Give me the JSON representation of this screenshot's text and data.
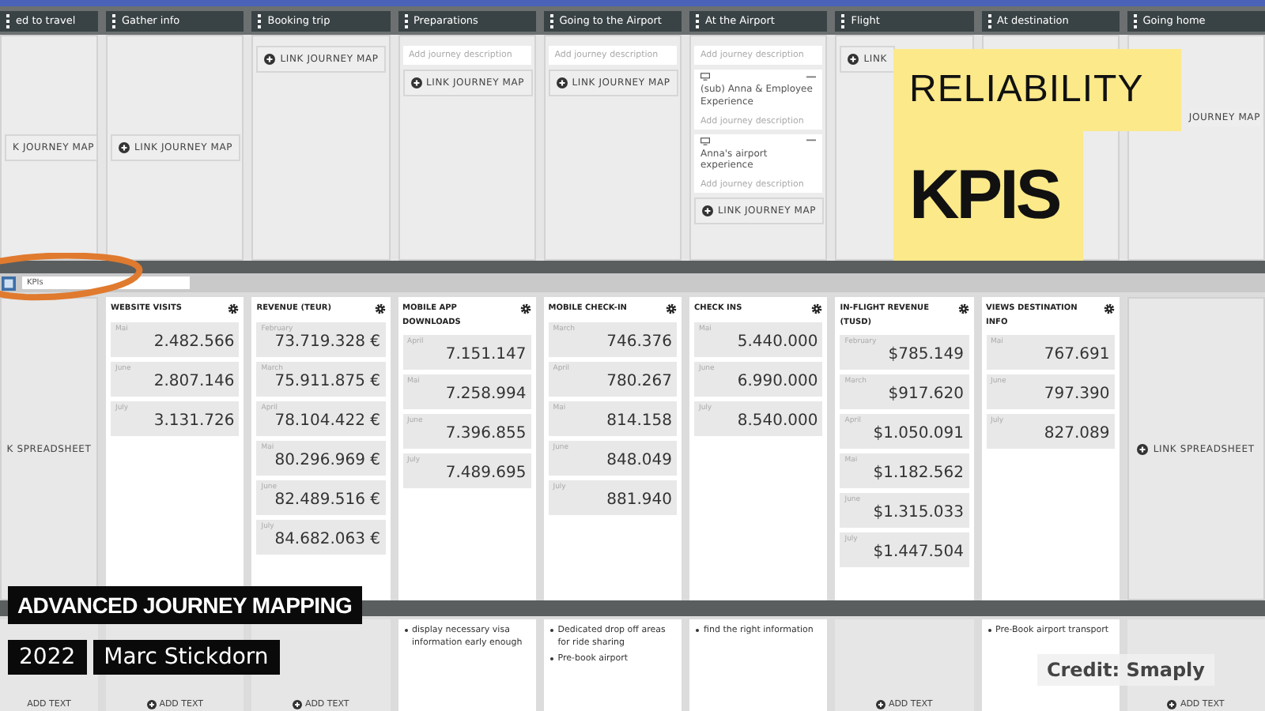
{
  "stages": [
    {
      "label": "ed to travel",
      "items": [
        {
          "kind": "link",
          "label": "K JOURNEY MAP",
          "icon": false
        }
      ]
    },
    {
      "label": "Gather info",
      "items": [
        {
          "kind": "link",
          "label": "LINK JOURNEY MAP",
          "icon": true
        }
      ]
    },
    {
      "label": "Booking trip",
      "items": [
        {
          "kind": "link",
          "label": "LINK JOURNEY MAP",
          "icon": true
        }
      ]
    },
    {
      "label": "Preparations",
      "items": [
        {
          "kind": "note",
          "text": "Add journey description"
        },
        {
          "kind": "link",
          "label": "LINK JOURNEY MAP",
          "icon": true
        }
      ]
    },
    {
      "label": "Going to the Airport",
      "items": [
        {
          "kind": "note",
          "text": "Add journey description"
        },
        {
          "kind": "link",
          "label": "LINK JOURNEY MAP",
          "icon": true
        }
      ]
    },
    {
      "label": "At the Airport",
      "items": [
        {
          "kind": "note",
          "text": "Add journey description"
        },
        {
          "kind": "subjourney",
          "title": "(sub) Anna & Employee Experience",
          "description": "Add journey description"
        },
        {
          "kind": "subjourney",
          "title": "Anna's airport experience",
          "description": "Add journey description"
        },
        {
          "kind": "link",
          "label": "LINK JOURNEY MAP",
          "icon": true
        }
      ]
    },
    {
      "label": "Flight",
      "items": [
        {
          "kind": "link",
          "label": "LINK",
          "icon": true
        }
      ]
    },
    {
      "label": "At destination"
    },
    {
      "label": "Going home",
      "items": [
        {
          "kind": "link",
          "label": "JOURNEY MAP",
          "icon": false
        }
      ]
    }
  ],
  "kpi_lane": {
    "name": "KPIs",
    "first_column": {
      "label": "K SPREADSHEET",
      "icon": false
    },
    "cards": [
      {
        "title": "WEBSITE VISITS",
        "entries": [
          {
            "month": "Mai",
            "value": "2.482.566"
          },
          {
            "month": "June",
            "value": "2.807.146"
          },
          {
            "month": "July",
            "value": "3.131.726"
          }
        ]
      },
      {
        "title": "REVENUE (TEUR)",
        "entries": [
          {
            "month": "February",
            "value": "73.719.328 €"
          },
          {
            "month": "March",
            "value": "75.911.875 €"
          },
          {
            "month": "April",
            "value": "78.104.422 €"
          },
          {
            "month": "Mai",
            "value": "80.296.969 €"
          },
          {
            "month": "June",
            "value": "82.489.516 €"
          },
          {
            "month": "July",
            "value": "84.682.063 €"
          }
        ]
      },
      {
        "title": "MOBILE APP DOWNLOADS",
        "entries": [
          {
            "month": "April",
            "value": "7.151.147"
          },
          {
            "month": "Mai",
            "value": "7.258.994"
          },
          {
            "month": "June",
            "value": "7.396.855"
          },
          {
            "month": "July",
            "value": "7.489.695"
          }
        ]
      },
      {
        "title": "MOBILE CHECK-IN",
        "entries": [
          {
            "month": "March",
            "value": "746.376"
          },
          {
            "month": "April",
            "value": "780.267"
          },
          {
            "month": "Mai",
            "value": "814.158"
          },
          {
            "month": "June",
            "value": "848.049"
          },
          {
            "month": "July",
            "value": "881.940"
          }
        ]
      },
      {
        "title": "CHECK INS",
        "entries": [
          {
            "month": "Mai",
            "value": "5.440.000"
          },
          {
            "month": "June",
            "value": "6.990.000"
          },
          {
            "month": "July",
            "value": "8.540.000"
          }
        ]
      },
      {
        "title": "IN-FLIGHT REVENUE (TUSD)",
        "entries": [
          {
            "month": "February",
            "value": "$785.149"
          },
          {
            "month": "March",
            "value": "$917.620"
          },
          {
            "month": "April",
            "value": "$1.050.091"
          },
          {
            "month": "Mai",
            "value": "$1.182.562"
          },
          {
            "month": "June",
            "value": "$1.315.033"
          },
          {
            "month": "July",
            "value": "$1.447.504"
          }
        ]
      },
      {
        "title": "VIEWS DESTINATION INFO",
        "entries": [
          {
            "month": "Mai",
            "value": "767.691"
          },
          {
            "month": "June",
            "value": "797.390"
          },
          {
            "month": "July",
            "value": "827.089"
          }
        ]
      }
    ],
    "last_column": {
      "label": "LINK SPREADSHEET",
      "icon": true
    }
  },
  "bottom_row": [
    {
      "kind": "add",
      "label": "ADD TEXT",
      "icon": false
    },
    {
      "kind": "add",
      "label": "ADD TEXT",
      "icon": true
    },
    {
      "kind": "add",
      "label": "ADD TEXT",
      "icon": true
    },
    {
      "kind": "bullets",
      "items": [
        "display necessary visa information early enough"
      ]
    },
    {
      "kind": "bullets",
      "items": [
        "Dedicated drop off areas for ride sharing",
        "Pre-book airport"
      ]
    },
    {
      "kind": "bullets",
      "items": [
        "find the right information"
      ]
    },
    {
      "kind": "add",
      "label": "ADD TEXT",
      "icon": true
    },
    {
      "kind": "bullets",
      "items": [
        "Pre-Book airport transport"
      ]
    },
    {
      "kind": "add",
      "label": "ADD TEXT",
      "icon": true
    }
  ],
  "overlays": {
    "tag_top": "RELIABILITY",
    "tag_bottom": "KPIS",
    "title": "ADVANCED JOURNEY MAPPING",
    "year": "2022",
    "author": "Marc Stickdorn",
    "credit": "Credit: Smaply"
  }
}
